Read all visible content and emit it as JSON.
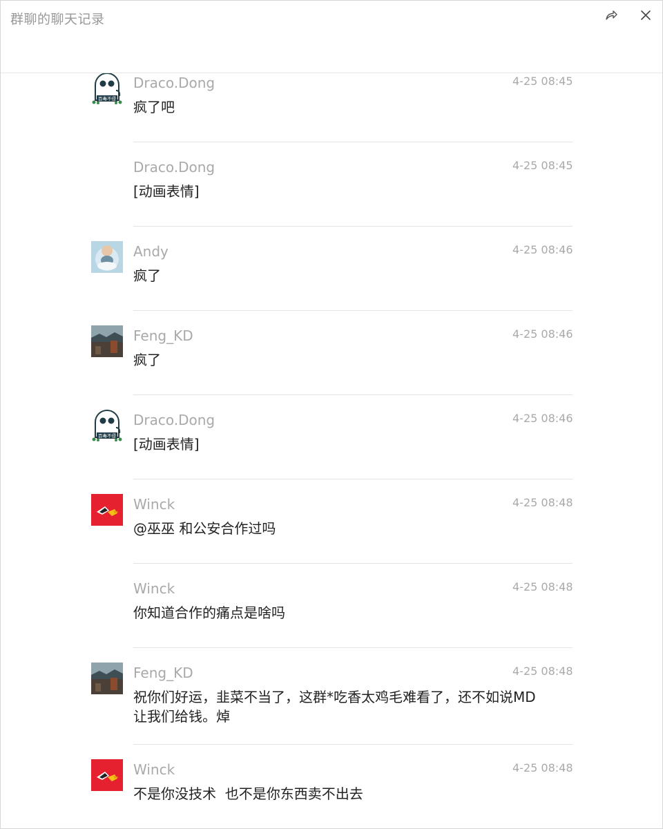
{
  "window": {
    "title": "群聊的聊天记录",
    "share_icon": "share-forward-icon",
    "close_icon": "close-icon"
  },
  "messages": [
    {
      "sender": "Draco.Dong",
      "time": "4-25 08:45",
      "text": "疯了吧",
      "avatar": "ghost-avatar",
      "avatar_label": "百毒不侵"
    },
    {
      "sender": "Draco.Dong",
      "time": "4-25 08:45",
      "text": "[动画表情]"
    },
    {
      "sender": "Andy",
      "time": "4-25 08:46",
      "text": "疯了",
      "avatar": "baby-avatar"
    },
    {
      "sender": "Feng_KD",
      "time": "4-25 08:46",
      "text": "疯了",
      "avatar": "landscape-avatar"
    },
    {
      "sender": "Draco.Dong",
      "time": "4-25 08:46",
      "text": "[动画表情]",
      "avatar": "ghost-avatar",
      "avatar_label": "百毒不侵"
    },
    {
      "sender": "Winck",
      "time": "4-25 08:48",
      "text": "@巫巫 和公安合作过吗",
      "avatar": "bird-avatar"
    },
    {
      "sender": "Winck",
      "time": "4-25 08:48",
      "text": "你知道合作的痛点是啥吗"
    },
    {
      "sender": "Feng_KD",
      "time": "4-25 08:48",
      "text": "祝你们好运，韭菜不当了，这群*吃香太鸡毛难看了，还不如说MD让我们给钱。焯",
      "avatar": "landscape-avatar"
    },
    {
      "sender": "Winck",
      "time": "4-25 08:48",
      "text": "不是你没技术  也不是你东西卖不出去",
      "avatar": "bird-avatar"
    }
  ]
}
